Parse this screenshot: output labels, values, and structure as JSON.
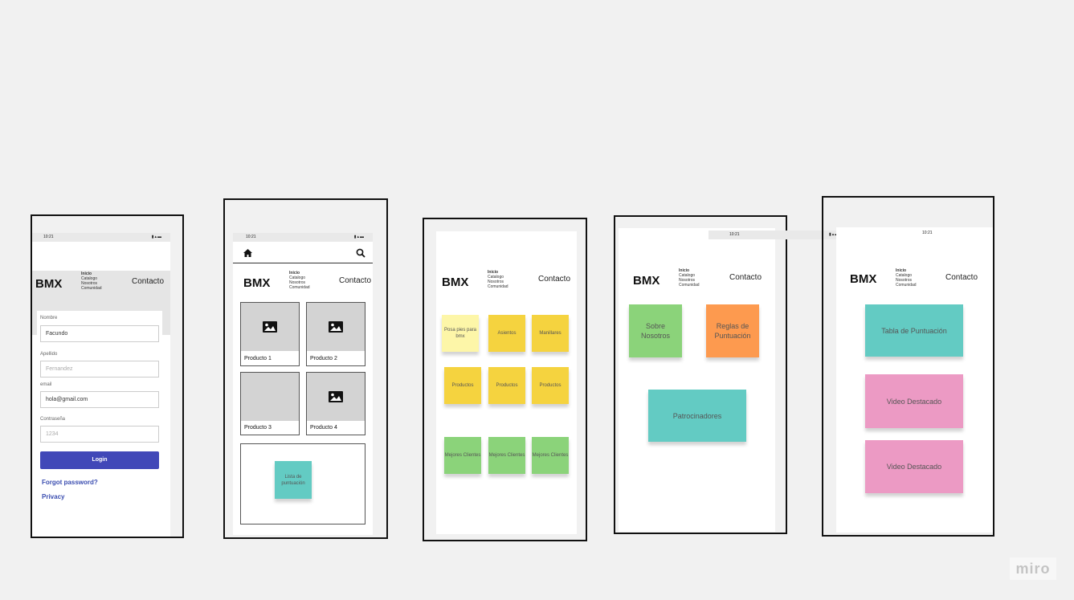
{
  "brand": "BMX",
  "status_time": "10:21",
  "nav": [
    "Inicio",
    "Catalogo",
    "Nosotros",
    "Comunidad"
  ],
  "contact": "Contacto",
  "login_screen": {
    "nombre_label": "Nombre",
    "nombre_value": "Facundo",
    "apellido_label": "Apellido",
    "apellido_placeholder": "Fernandez",
    "email_label": "email",
    "email_value": "hola@gmail.com",
    "password_label": "Contraseña",
    "password_placeholder": "1234",
    "login_button": "Login",
    "forgot_link": "Forgot password?",
    "privacy_link": "Privacy"
  },
  "catalog_screen": {
    "products": [
      "Producto 1",
      "Producto 2",
      "Producto 3",
      "Producto 4"
    ],
    "score_note": "Lista de puntuación"
  },
  "category_screen": {
    "row1": [
      "Posa pies para bmx",
      "Asientos",
      "Manillares"
    ],
    "row2": [
      "Productos",
      "Productos",
      "Productos"
    ],
    "row3": [
      "Mejores Clientes",
      "Mejores Clientes",
      "Mejores Clientes"
    ]
  },
  "about_screen": {
    "sobre": "Sobre Nosotros",
    "reglas": "Reglas de Puntuación",
    "patrocinadores": "Patrocinadores"
  },
  "community_screen": {
    "tabla": "Tabla de Puntuación",
    "video1": "Video Destacado",
    "video2": "Video Destacado"
  },
  "watermark": "miro",
  "colors": {
    "light_yellow": "#fdf6a8",
    "yellow": "#f5d33f",
    "green": "#8bd37a",
    "orange": "#fd9a4f",
    "teal": "#63cbc3",
    "pink": "#ec9ac4",
    "button_blue": "#4148b8",
    "link_blue": "#3a4db0"
  }
}
